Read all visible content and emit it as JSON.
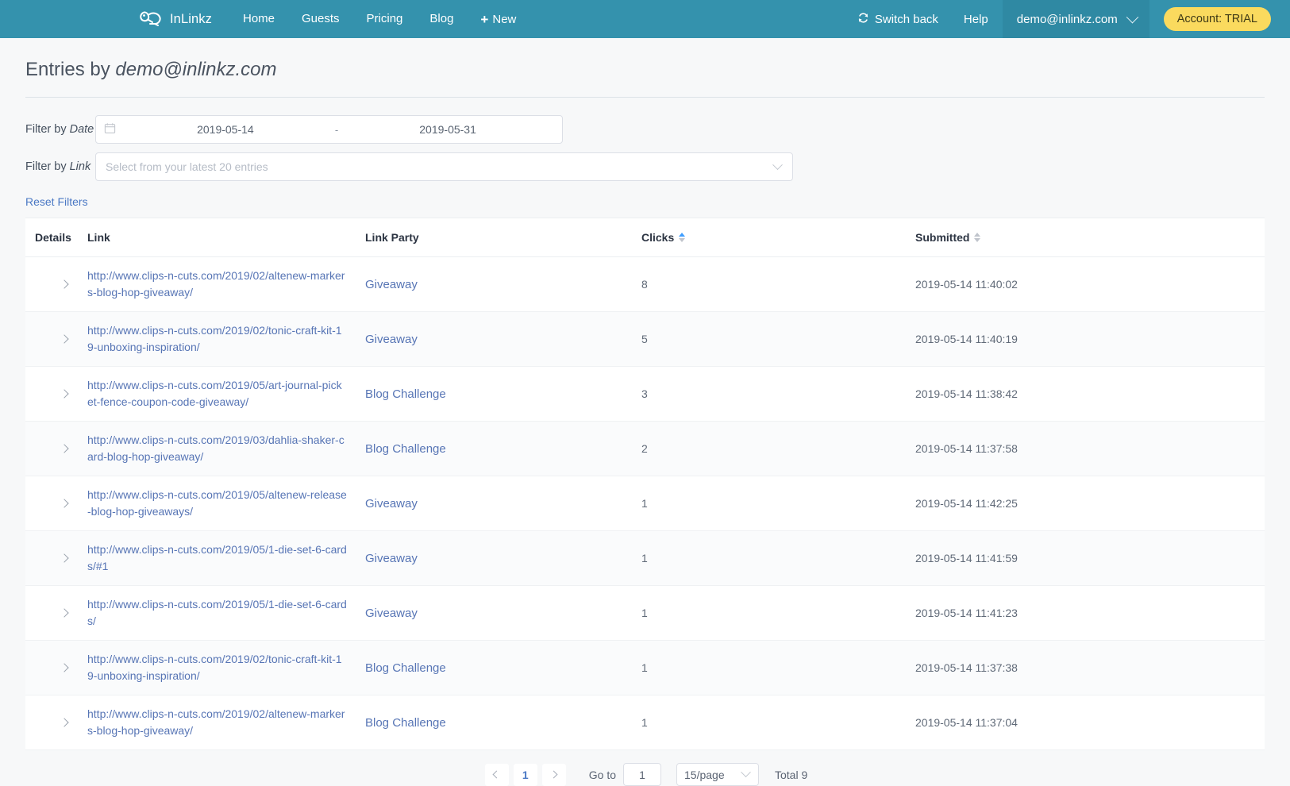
{
  "navbar": {
    "brand_icon": "inlinkz-frog-logo",
    "brand": "InLinkz",
    "links": [
      "Home",
      "Guests",
      "Pricing",
      "Blog"
    ],
    "new_label": "New",
    "new_icon": "plus-icon",
    "switch_back": "Switch back",
    "switch_back_icon": "refresh-icon",
    "help": "Help",
    "user_email": "demo@inlinkz.com",
    "user_chevron_icon": "chevron-down-icon",
    "account_badge": "Account: TRIAL",
    "bg_color": "#3492ad",
    "badge_color": "#fada5e"
  },
  "page": {
    "title_prefix": "Entries by ",
    "title_email": "demo@inlinkz.com"
  },
  "filters": {
    "date_label_prefix": "Filter by ",
    "date_label_em": "Date",
    "date_icon": "calendar-icon",
    "date_start": "2019-05-14",
    "date_separator": "-",
    "date_end": "2019-05-31",
    "link_label_prefix": "Filter by ",
    "link_label_em": "Link",
    "link_placeholder": "Select from your latest 20 entries",
    "link_value": "",
    "link_chevron_icon": "chevron-down-icon",
    "reset": "Reset Filters"
  },
  "table": {
    "columns": [
      "Details",
      "Link",
      "Link Party",
      "Clicks",
      "Submitted"
    ],
    "clicks_sort": "ascending",
    "submitted_sort": "none",
    "expand_icon": "chevron-right-icon",
    "rows": [
      {
        "link": "http://www.clips-n-cuts.com/2019/02/altenew-markers-blog-hop-giveaway/",
        "party": "Giveaway",
        "clicks": "8",
        "submitted": "2019-05-14 11:40:02"
      },
      {
        "link": "http://www.clips-n-cuts.com/2019/02/tonic-craft-kit-19-unboxing-inspiration/",
        "party": "Giveaway",
        "clicks": "5",
        "submitted": "2019-05-14 11:40:19"
      },
      {
        "link": "http://www.clips-n-cuts.com/2019/05/art-journal-picket-fence-coupon-code-giveaway/",
        "party": "Blog Challenge",
        "clicks": "3",
        "submitted": "2019-05-14 11:38:42"
      },
      {
        "link": "http://www.clips-n-cuts.com/2019/03/dahlia-shaker-card-blog-hop-giveaway/",
        "party": "Blog Challenge",
        "clicks": "2",
        "submitted": "2019-05-14 11:37:58"
      },
      {
        "link": "http://www.clips-n-cuts.com/2019/05/altenew-release-blog-hop-giveaways/",
        "party": "Giveaway",
        "clicks": "1",
        "submitted": "2019-05-14 11:42:25"
      },
      {
        "link": "http://www.clips-n-cuts.com/2019/05/1-die-set-6-cards/#1",
        "party": "Giveaway",
        "clicks": "1",
        "submitted": "2019-05-14 11:41:59"
      },
      {
        "link": "http://www.clips-n-cuts.com/2019/05/1-die-set-6-cards/",
        "party": "Giveaway",
        "clicks": "1",
        "submitted": "2019-05-14 11:41:23"
      },
      {
        "link": "http://www.clips-n-cuts.com/2019/02/tonic-craft-kit-19-unboxing-inspiration/",
        "party": "Blog Challenge",
        "clicks": "1",
        "submitted": "2019-05-14 11:37:38"
      },
      {
        "link": "http://www.clips-n-cuts.com/2019/02/altenew-markers-blog-hop-giveaway/",
        "party": "Blog Challenge",
        "clicks": "1",
        "submitted": "2019-05-14 11:37:04"
      }
    ]
  },
  "pagination": {
    "prev_icon": "chevron-left-icon",
    "next_icon": "chevron-right-icon",
    "current_page": "1",
    "goto_label": "Go to",
    "goto_value": "1",
    "page_size": "15/page",
    "page_size_chevron_icon": "chevron-down-icon",
    "total": "Total 9"
  }
}
